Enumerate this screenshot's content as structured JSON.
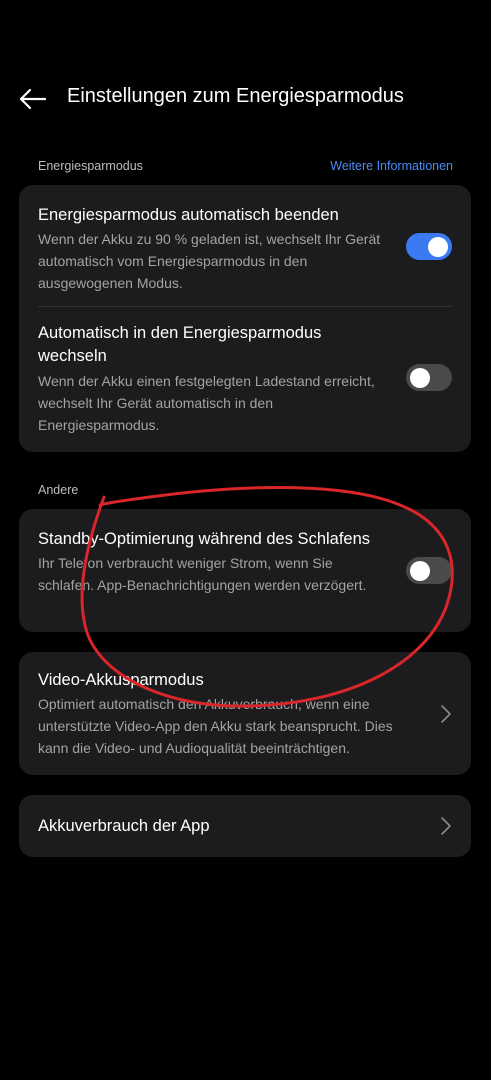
{
  "header": {
    "title": "Einstellungen zum Energiesparmodus",
    "back_icon": "arrow-left-icon"
  },
  "section_energy": {
    "label": "Energiesparmodus",
    "link": "Weitere Informationen",
    "link_color": "#4c8bf5"
  },
  "auto_exit": {
    "title": "Energiesparmodus automatisch beenden",
    "description": "Wenn der Akku zu 90 % geladen ist, wechselt Ihr Gerät automatisch vom Energiesparmodus in den ausgewogenen Modus.",
    "enabled": true
  },
  "auto_enter": {
    "title": "Automatisch in den Energiesparmodus wechseln",
    "description": "Wenn der Akku einen festgelegten Ladestand erreicht, wechselt Ihr Gerät automatisch in den Energiesparmodus.",
    "enabled": false
  },
  "section_other": {
    "label": "Andere"
  },
  "standby": {
    "title": "Standby-Optimierung während des Schlafens",
    "description": "Ihr Telefon verbraucht weniger Strom, wenn Sie schlafen. App-Benachrichtigungen werden verzögert.",
    "enabled": false
  },
  "video": {
    "title": "Video-Akkusparmodus",
    "description": "Optimiert automatisch den Akkuverbrauch, wenn eine unterstützte Video-App den Akku stark beansprucht. Dies kann die Video- und Audioqualität beeinträchtigen.",
    "icon": "chevron-right-icon"
  },
  "app_usage": {
    "title": "Akkuverbrauch der App",
    "icon": "chevron-right-icon"
  },
  "colors": {
    "background": "#000000",
    "card": "#1c1c1e",
    "toggle_on": "#3a7bf3",
    "toggle_off": "#4a4a4c",
    "annotation_circle": "#d8262b"
  }
}
